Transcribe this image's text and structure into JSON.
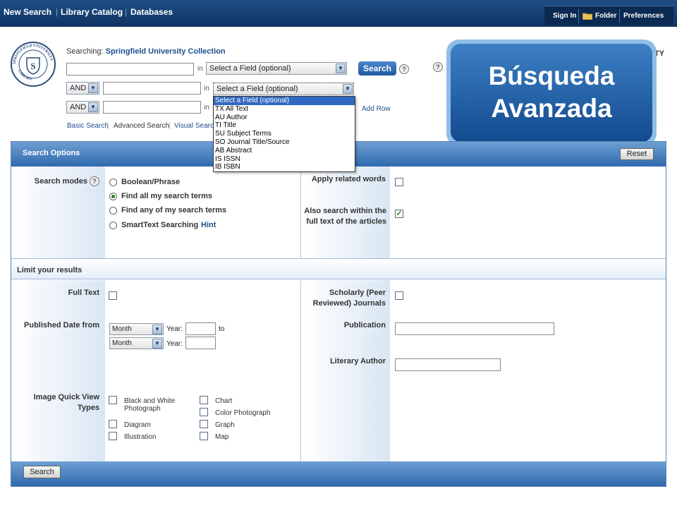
{
  "nav": {
    "links": [
      "New Search",
      "Library Catalog",
      "Databases"
    ],
    "tools": [
      "Sign In",
      "Folder",
      "Preferences"
    ],
    "folder_icon": "folder-icon"
  },
  "logo": {
    "text": "SPRINGFIELD UNIVERSITY LIBRARY"
  },
  "search": {
    "searching_label": "Searching:",
    "collection": "Springfield University Collection",
    "in_label": "in",
    "field_placeholder": "Select a Field (optional)",
    "bool1": "AND",
    "bool2": "AND",
    "search_button": "Search",
    "help": "?",
    "add_row": "Add Row",
    "links": [
      "Basic Search",
      "Advanced Search",
      "Visual Search"
    ],
    "dropdown_options": [
      "Select a Field (optional)",
      "TX All Text",
      "AU Author",
      "TI Title",
      "SU Subject Terms",
      "SO Journal Title/Source",
      "AB Abstract",
      "IS ISSN",
      "IB ISBN"
    ],
    "dropdown_selected_index": 0,
    "cut_off_text": "TY"
  },
  "callout": {
    "line1": "Búsqueda",
    "line2": "Avanzada"
  },
  "options": {
    "title": "Search Options",
    "reset": "Reset",
    "search_modes_label": "Search modes",
    "modes": [
      "Boolean/Phrase",
      "Find all my search terms",
      "Find any of my search terms",
      "SmartText Searching"
    ],
    "modes_selected": 1,
    "hint": "Hint",
    "apply_related": "Apply related words",
    "apply_related_checked": false,
    "also_search_l1": "Also search within the",
    "also_search_l2": "full text of the articles",
    "also_search_checked": true
  },
  "limits": {
    "title": "Limit your results",
    "full_text": "Full Text",
    "scholarly_l1": "Scholarly (Peer",
    "scholarly_l2": "Reviewed) Journals",
    "published_date": "Published Date from",
    "month": "Month",
    "year_label": "Year:",
    "to_label": "to",
    "publication": "Publication",
    "literary_author": "Literary Author",
    "image_l1": "Image Quick View",
    "image_l2": "Types",
    "image_types_left": [
      "Black and White Photograph",
      "Diagram",
      "Illustration"
    ],
    "image_types_right": [
      "Chart",
      "Color Photograph",
      "Graph",
      "Map"
    ],
    "bw_l1": "Black and White",
    "bw_l2": "Photograph"
  },
  "footer": {
    "search": "Search"
  }
}
